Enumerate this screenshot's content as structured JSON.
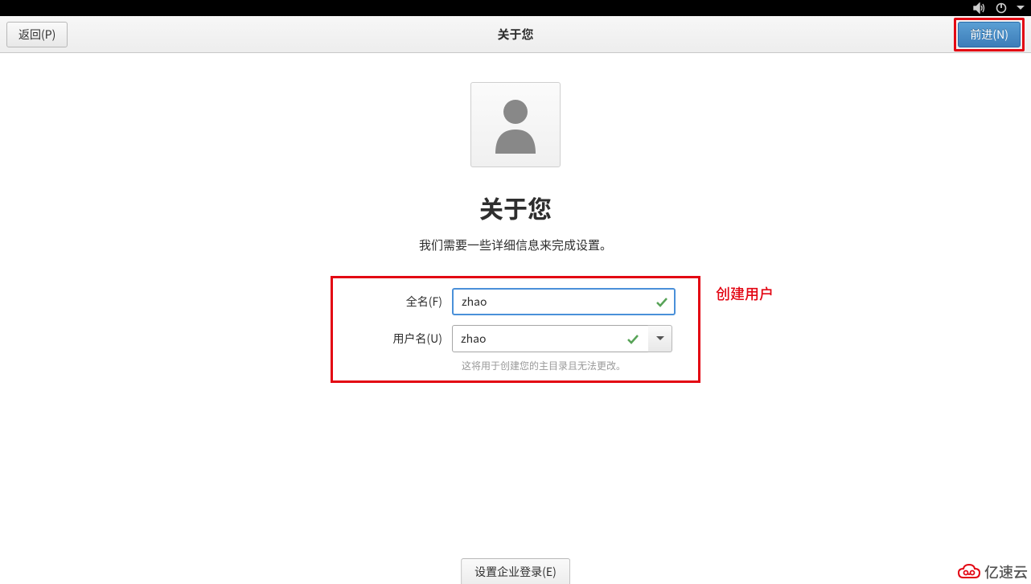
{
  "header": {
    "back_label": "返回(P)",
    "title": "关于您",
    "forward_label": "前进(N)"
  },
  "page": {
    "heading": "关于您",
    "subheading": "我们需要一些详细信息来完成设置。"
  },
  "form": {
    "fullname_label": "全名(F)",
    "fullname_value": "zhao",
    "username_label": "用户名(U)",
    "username_value": "zhao",
    "help_text": "这将用于创建您的主目录且无法更改。"
  },
  "annotation": {
    "create_user": "创建用户"
  },
  "footer": {
    "enterprise_label": "设置企业登录(E)"
  },
  "watermark": {
    "text": "亿速云"
  },
  "icons": {
    "volume": "volume-icon",
    "power": "power-icon",
    "menu": "menu-down-icon",
    "avatar": "user-avatar-icon",
    "check": "check-icon",
    "dropdown": "chevron-down-icon"
  },
  "colors": {
    "highlight": "#e30613",
    "primary_button": "#4a90d9",
    "annotation_text": "#e30613"
  }
}
